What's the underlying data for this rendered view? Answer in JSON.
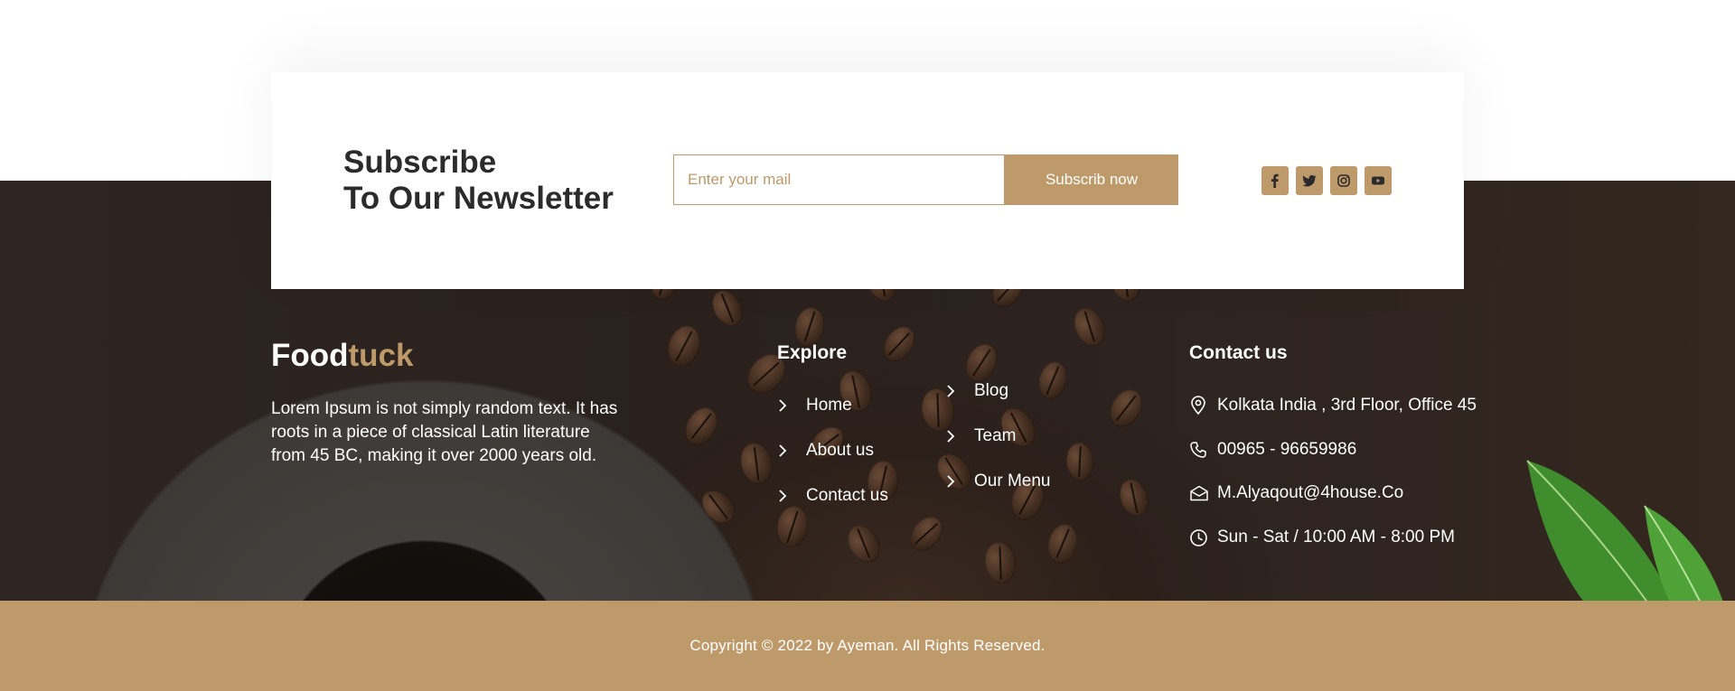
{
  "newsletter": {
    "title_line1": "Subscribe",
    "title_line2": "To Our Newsletter",
    "input_placeholder": "Enter your mail",
    "button_label": "Subscrib now",
    "socials": [
      "facebook-icon",
      "twitter-icon",
      "instagram-icon",
      "youtube-icon"
    ]
  },
  "brand": {
    "part1": "Food",
    "part2": "tuck"
  },
  "about_text": "Lorem Ipsum is not simply random text. It has roots in a piece of classical Latin literature from 45 BC, making it over 2000 years old.",
  "explore": {
    "title": "Explore",
    "col1": [
      "Home",
      "About us",
      "Contact us"
    ],
    "col2": [
      "Blog",
      "Team",
      "Our Menu"
    ]
  },
  "contact": {
    "title": "Contact us",
    "address": "Kolkata India , 3rd Floor, Office 45",
    "phone": "00965 - 96659986",
    "email": "M.Alyaqout@4house.Co",
    "hours": "Sun - Sat / 10:00 AM - 8:00 PM"
  },
  "copyright": "Copyright © 2022 by Ayeman. All Rights Reserved.",
  "colors": {
    "accent": "#be9a6b",
    "dark": "#2b2b2b",
    "footer_bg": "#2e2522"
  }
}
